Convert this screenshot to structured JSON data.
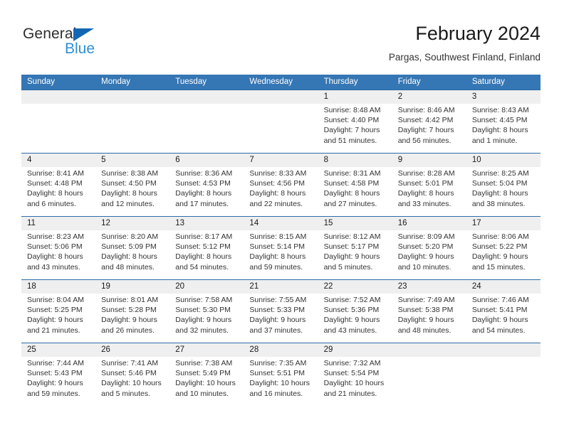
{
  "logo": {
    "word_one": "General",
    "word_two": "Blue",
    "triangle_color": "#1267b5",
    "blue_color": "#2f8fd8"
  },
  "header": {
    "title": "February 2024",
    "subtitle": "Pargas, Southwest Finland, Finland"
  },
  "theme": {
    "header_bar": "#3576b4",
    "row_divider": "#2c6ca8",
    "date_band": "#efefef"
  },
  "weekdays": [
    "Sunday",
    "Monday",
    "Tuesday",
    "Wednesday",
    "Thursday",
    "Friday",
    "Saturday"
  ],
  "weeks": [
    [
      {
        "day": "",
        "sunrise": "",
        "sunset": "",
        "daylight_line1": "",
        "daylight_line2": ""
      },
      {
        "day": "",
        "sunrise": "",
        "sunset": "",
        "daylight_line1": "",
        "daylight_line2": ""
      },
      {
        "day": "",
        "sunrise": "",
        "sunset": "",
        "daylight_line1": "",
        "daylight_line2": ""
      },
      {
        "day": "",
        "sunrise": "",
        "sunset": "",
        "daylight_line1": "",
        "daylight_line2": ""
      },
      {
        "day": "1",
        "sunrise": "Sunrise: 8:48 AM",
        "sunset": "Sunset: 4:40 PM",
        "daylight_line1": "Daylight: 7 hours",
        "daylight_line2": "and 51 minutes."
      },
      {
        "day": "2",
        "sunrise": "Sunrise: 8:46 AM",
        "sunset": "Sunset: 4:42 PM",
        "daylight_line1": "Daylight: 7 hours",
        "daylight_line2": "and 56 minutes."
      },
      {
        "day": "3",
        "sunrise": "Sunrise: 8:43 AM",
        "sunset": "Sunset: 4:45 PM",
        "daylight_line1": "Daylight: 8 hours",
        "daylight_line2": "and 1 minute."
      }
    ],
    [
      {
        "day": "4",
        "sunrise": "Sunrise: 8:41 AM",
        "sunset": "Sunset: 4:48 PM",
        "daylight_line1": "Daylight: 8 hours",
        "daylight_line2": "and 6 minutes."
      },
      {
        "day": "5",
        "sunrise": "Sunrise: 8:38 AM",
        "sunset": "Sunset: 4:50 PM",
        "daylight_line1": "Daylight: 8 hours",
        "daylight_line2": "and 12 minutes."
      },
      {
        "day": "6",
        "sunrise": "Sunrise: 8:36 AM",
        "sunset": "Sunset: 4:53 PM",
        "daylight_line1": "Daylight: 8 hours",
        "daylight_line2": "and 17 minutes."
      },
      {
        "day": "7",
        "sunrise": "Sunrise: 8:33 AM",
        "sunset": "Sunset: 4:56 PM",
        "daylight_line1": "Daylight: 8 hours",
        "daylight_line2": "and 22 minutes."
      },
      {
        "day": "8",
        "sunrise": "Sunrise: 8:31 AM",
        "sunset": "Sunset: 4:58 PM",
        "daylight_line1": "Daylight: 8 hours",
        "daylight_line2": "and 27 minutes."
      },
      {
        "day": "9",
        "sunrise": "Sunrise: 8:28 AM",
        "sunset": "Sunset: 5:01 PM",
        "daylight_line1": "Daylight: 8 hours",
        "daylight_line2": "and 33 minutes."
      },
      {
        "day": "10",
        "sunrise": "Sunrise: 8:25 AM",
        "sunset": "Sunset: 5:04 PM",
        "daylight_line1": "Daylight: 8 hours",
        "daylight_line2": "and 38 minutes."
      }
    ],
    [
      {
        "day": "11",
        "sunrise": "Sunrise: 8:23 AM",
        "sunset": "Sunset: 5:06 PM",
        "daylight_line1": "Daylight: 8 hours",
        "daylight_line2": "and 43 minutes."
      },
      {
        "day": "12",
        "sunrise": "Sunrise: 8:20 AM",
        "sunset": "Sunset: 5:09 PM",
        "daylight_line1": "Daylight: 8 hours",
        "daylight_line2": "and 48 minutes."
      },
      {
        "day": "13",
        "sunrise": "Sunrise: 8:17 AM",
        "sunset": "Sunset: 5:12 PM",
        "daylight_line1": "Daylight: 8 hours",
        "daylight_line2": "and 54 minutes."
      },
      {
        "day": "14",
        "sunrise": "Sunrise: 8:15 AM",
        "sunset": "Sunset: 5:14 PM",
        "daylight_line1": "Daylight: 8 hours",
        "daylight_line2": "and 59 minutes."
      },
      {
        "day": "15",
        "sunrise": "Sunrise: 8:12 AM",
        "sunset": "Sunset: 5:17 PM",
        "daylight_line1": "Daylight: 9 hours",
        "daylight_line2": "and 5 minutes."
      },
      {
        "day": "16",
        "sunrise": "Sunrise: 8:09 AM",
        "sunset": "Sunset: 5:20 PM",
        "daylight_line1": "Daylight: 9 hours",
        "daylight_line2": "and 10 minutes."
      },
      {
        "day": "17",
        "sunrise": "Sunrise: 8:06 AM",
        "sunset": "Sunset: 5:22 PM",
        "daylight_line1": "Daylight: 9 hours",
        "daylight_line2": "and 15 minutes."
      }
    ],
    [
      {
        "day": "18",
        "sunrise": "Sunrise: 8:04 AM",
        "sunset": "Sunset: 5:25 PM",
        "daylight_line1": "Daylight: 9 hours",
        "daylight_line2": "and 21 minutes."
      },
      {
        "day": "19",
        "sunrise": "Sunrise: 8:01 AM",
        "sunset": "Sunset: 5:28 PM",
        "daylight_line1": "Daylight: 9 hours",
        "daylight_line2": "and 26 minutes."
      },
      {
        "day": "20",
        "sunrise": "Sunrise: 7:58 AM",
        "sunset": "Sunset: 5:30 PM",
        "daylight_line1": "Daylight: 9 hours",
        "daylight_line2": "and 32 minutes."
      },
      {
        "day": "21",
        "sunrise": "Sunrise: 7:55 AM",
        "sunset": "Sunset: 5:33 PM",
        "daylight_line1": "Daylight: 9 hours",
        "daylight_line2": "and 37 minutes."
      },
      {
        "day": "22",
        "sunrise": "Sunrise: 7:52 AM",
        "sunset": "Sunset: 5:36 PM",
        "daylight_line1": "Daylight: 9 hours",
        "daylight_line2": "and 43 minutes."
      },
      {
        "day": "23",
        "sunrise": "Sunrise: 7:49 AM",
        "sunset": "Sunset: 5:38 PM",
        "daylight_line1": "Daylight: 9 hours",
        "daylight_line2": "and 48 minutes."
      },
      {
        "day": "24",
        "sunrise": "Sunrise: 7:46 AM",
        "sunset": "Sunset: 5:41 PM",
        "daylight_line1": "Daylight: 9 hours",
        "daylight_line2": "and 54 minutes."
      }
    ],
    [
      {
        "day": "25",
        "sunrise": "Sunrise: 7:44 AM",
        "sunset": "Sunset: 5:43 PM",
        "daylight_line1": "Daylight: 9 hours",
        "daylight_line2": "and 59 minutes."
      },
      {
        "day": "26",
        "sunrise": "Sunrise: 7:41 AM",
        "sunset": "Sunset: 5:46 PM",
        "daylight_line1": "Daylight: 10 hours",
        "daylight_line2": "and 5 minutes."
      },
      {
        "day": "27",
        "sunrise": "Sunrise: 7:38 AM",
        "sunset": "Sunset: 5:49 PM",
        "daylight_line1": "Daylight: 10 hours",
        "daylight_line2": "and 10 minutes."
      },
      {
        "day": "28",
        "sunrise": "Sunrise: 7:35 AM",
        "sunset": "Sunset: 5:51 PM",
        "daylight_line1": "Daylight: 10 hours",
        "daylight_line2": "and 16 minutes."
      },
      {
        "day": "29",
        "sunrise": "Sunrise: 7:32 AM",
        "sunset": "Sunset: 5:54 PM",
        "daylight_line1": "Daylight: 10 hours",
        "daylight_line2": "and 21 minutes."
      },
      {
        "day": "",
        "sunrise": "",
        "sunset": "",
        "daylight_line1": "",
        "daylight_line2": ""
      },
      {
        "day": "",
        "sunrise": "",
        "sunset": "",
        "daylight_line1": "",
        "daylight_line2": ""
      }
    ]
  ]
}
